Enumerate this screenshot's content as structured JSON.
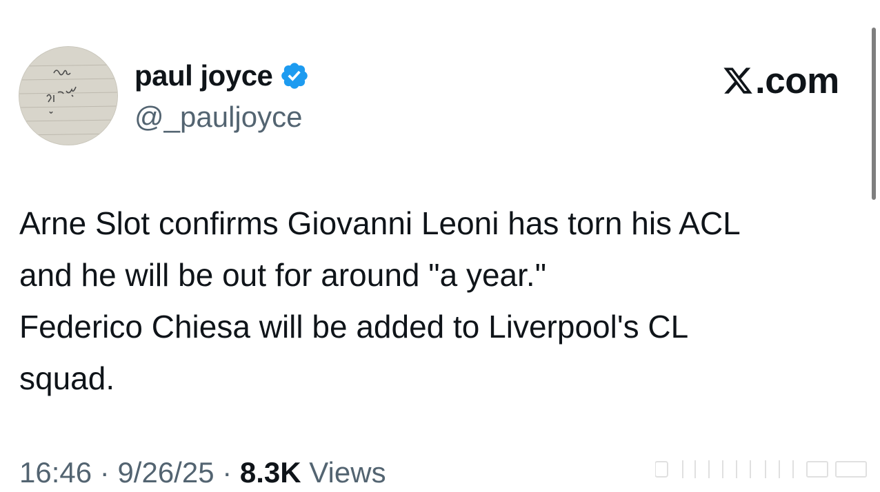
{
  "author": {
    "display_name": "paul joyce",
    "handle": "@_pauljoyce",
    "verified": true,
    "verified_color": "#1d9bf0"
  },
  "brand": {
    "domain": ".com"
  },
  "tweet": {
    "text": "Arne Slot confirms Giovanni Leoni has torn his ACL\nand he will be out for around \"a year.\"\nFederico Chiesa will be added to Liverpool's CL\nsquad."
  },
  "meta": {
    "time": "16:46",
    "date": "9/26/25",
    "views_count": "8.3K",
    "views_label": "Views",
    "separator": " · "
  },
  "icons": {
    "avatar": "handwritten-note-avatar",
    "verified": "verified-badge-icon",
    "logo": "x-logo-icon"
  },
  "colors": {
    "text_primary": "#0f1419",
    "text_secondary": "#536471",
    "background": "#ffffff"
  }
}
